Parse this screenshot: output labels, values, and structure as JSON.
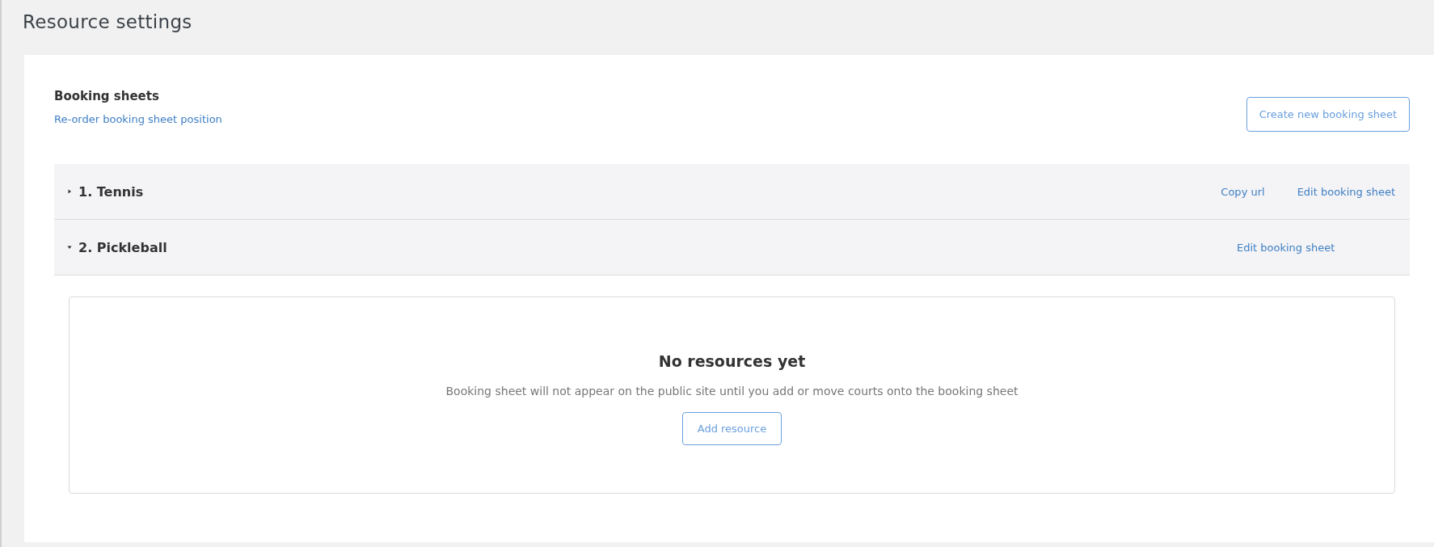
{
  "page": {
    "title": "Resource settings"
  },
  "booking_sheets": {
    "heading": "Booking sheets",
    "reorder_link": "Re-order booking sheet position",
    "create_button": "Create new booking sheet",
    "sheets": [
      {
        "label": "1. Tennis",
        "expanded": false,
        "actions": [
          "Copy url",
          "Edit booking sheet"
        ]
      },
      {
        "label": "2. Pickleball",
        "expanded": true,
        "actions": [
          "Edit booking sheet"
        ],
        "empty_state": {
          "title": "No resources yet",
          "message": "Booking sheet will not appear on the public site until you add or move courts onto the booking sheet",
          "button": "Add resource"
        }
      }
    ]
  }
}
